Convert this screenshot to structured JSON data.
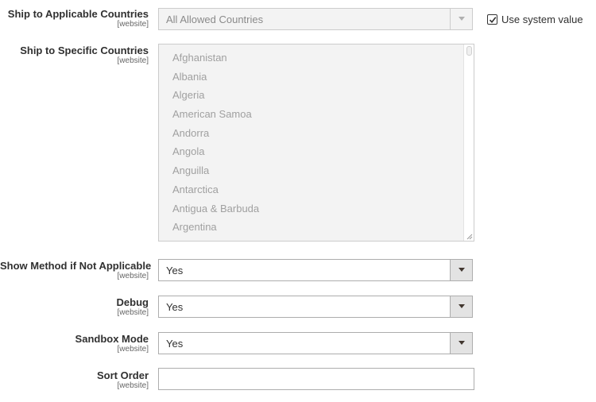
{
  "fields": {
    "applicable": {
      "label": "Ship to Applicable Countries",
      "scope": "[website]",
      "value": "All Allowed Countries"
    },
    "use_system": {
      "label": "Use system value",
      "checked": true
    },
    "specific": {
      "label": "Ship to Specific Countries",
      "scope": "[website]",
      "options": [
        "Afghanistan",
        "Albania",
        "Algeria",
        "American Samoa",
        "Andorra",
        "Angola",
        "Anguilla",
        "Antarctica",
        "Antigua & Barbuda",
        "Argentina"
      ]
    },
    "show_method": {
      "label": "Show Method if Not Applicable",
      "scope": "[website]",
      "value": "Yes"
    },
    "debug": {
      "label": "Debug",
      "scope": "[website]",
      "value": "Yes"
    },
    "sandbox": {
      "label": "Sandbox Mode",
      "scope": "[website]",
      "value": "Yes"
    },
    "sort_order": {
      "label": "Sort Order",
      "scope": "[website]",
      "value": ""
    }
  },
  "colors": {
    "text": "#303030",
    "scope": "#666666",
    "disabled_bg": "#f3f3f3",
    "border": "#adadad"
  }
}
